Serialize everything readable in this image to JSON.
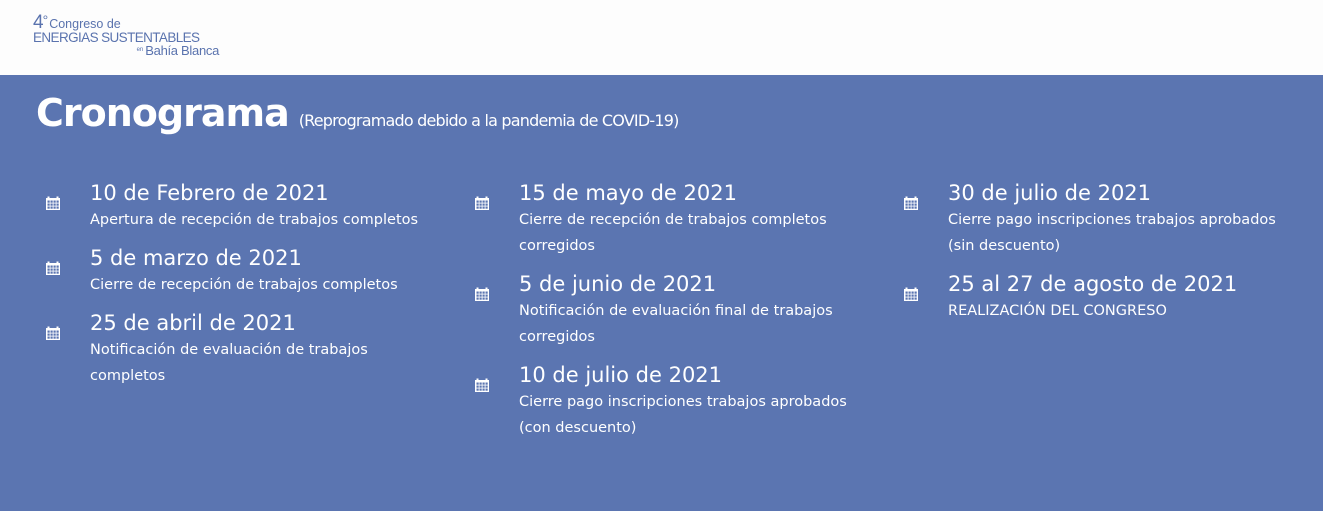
{
  "header": {
    "logo": {
      "number": "4",
      "degree": "°",
      "line1": "Congreso de",
      "line2": "ENERGIAS SUSTENTABLES",
      "en": "en",
      "city": "Bahía Blanca"
    }
  },
  "main": {
    "title": "Cronograma",
    "subtitle": "(Reprogramado debido a la pandemia de COVID-19)"
  },
  "schedule": {
    "col1": [
      {
        "date": "10 de Febrero de 2021",
        "desc": "Apertura de recepción de trabajos completos"
      },
      {
        "date": "5 de marzo de 2021",
        "desc": "Cierre de recepción de trabajos completos"
      },
      {
        "date": "25 de abril de 2021",
        "desc": "Notificación de evaluación de trabajos completos"
      }
    ],
    "col2": [
      {
        "date": "15 de mayo de 2021",
        "desc": "Cierre de recepción de trabajos completos corregidos"
      },
      {
        "date": "5 de junio de 2021",
        "desc": "Notificación de evaluación final de trabajos corregidos"
      },
      {
        "date": "10 de julio de 2021",
        "desc": "Cierre pago inscripciones trabajos aprobados (con descuento)"
      }
    ],
    "col3": [
      {
        "date": "30 de julio de 2021",
        "desc": "Cierre pago inscripciones trabajos aprobados (sin descuento)"
      },
      {
        "date": "25 al 27 de agosto de 2021",
        "desc": "REALIZACIÓN DEL CONGRESO"
      }
    ]
  },
  "icons": {
    "event": "calendar-icon"
  },
  "colors": {
    "background": "#5b75b1",
    "header": "#fdfdfd",
    "logo": "#5a73ae",
    "text": "#ffffff"
  }
}
